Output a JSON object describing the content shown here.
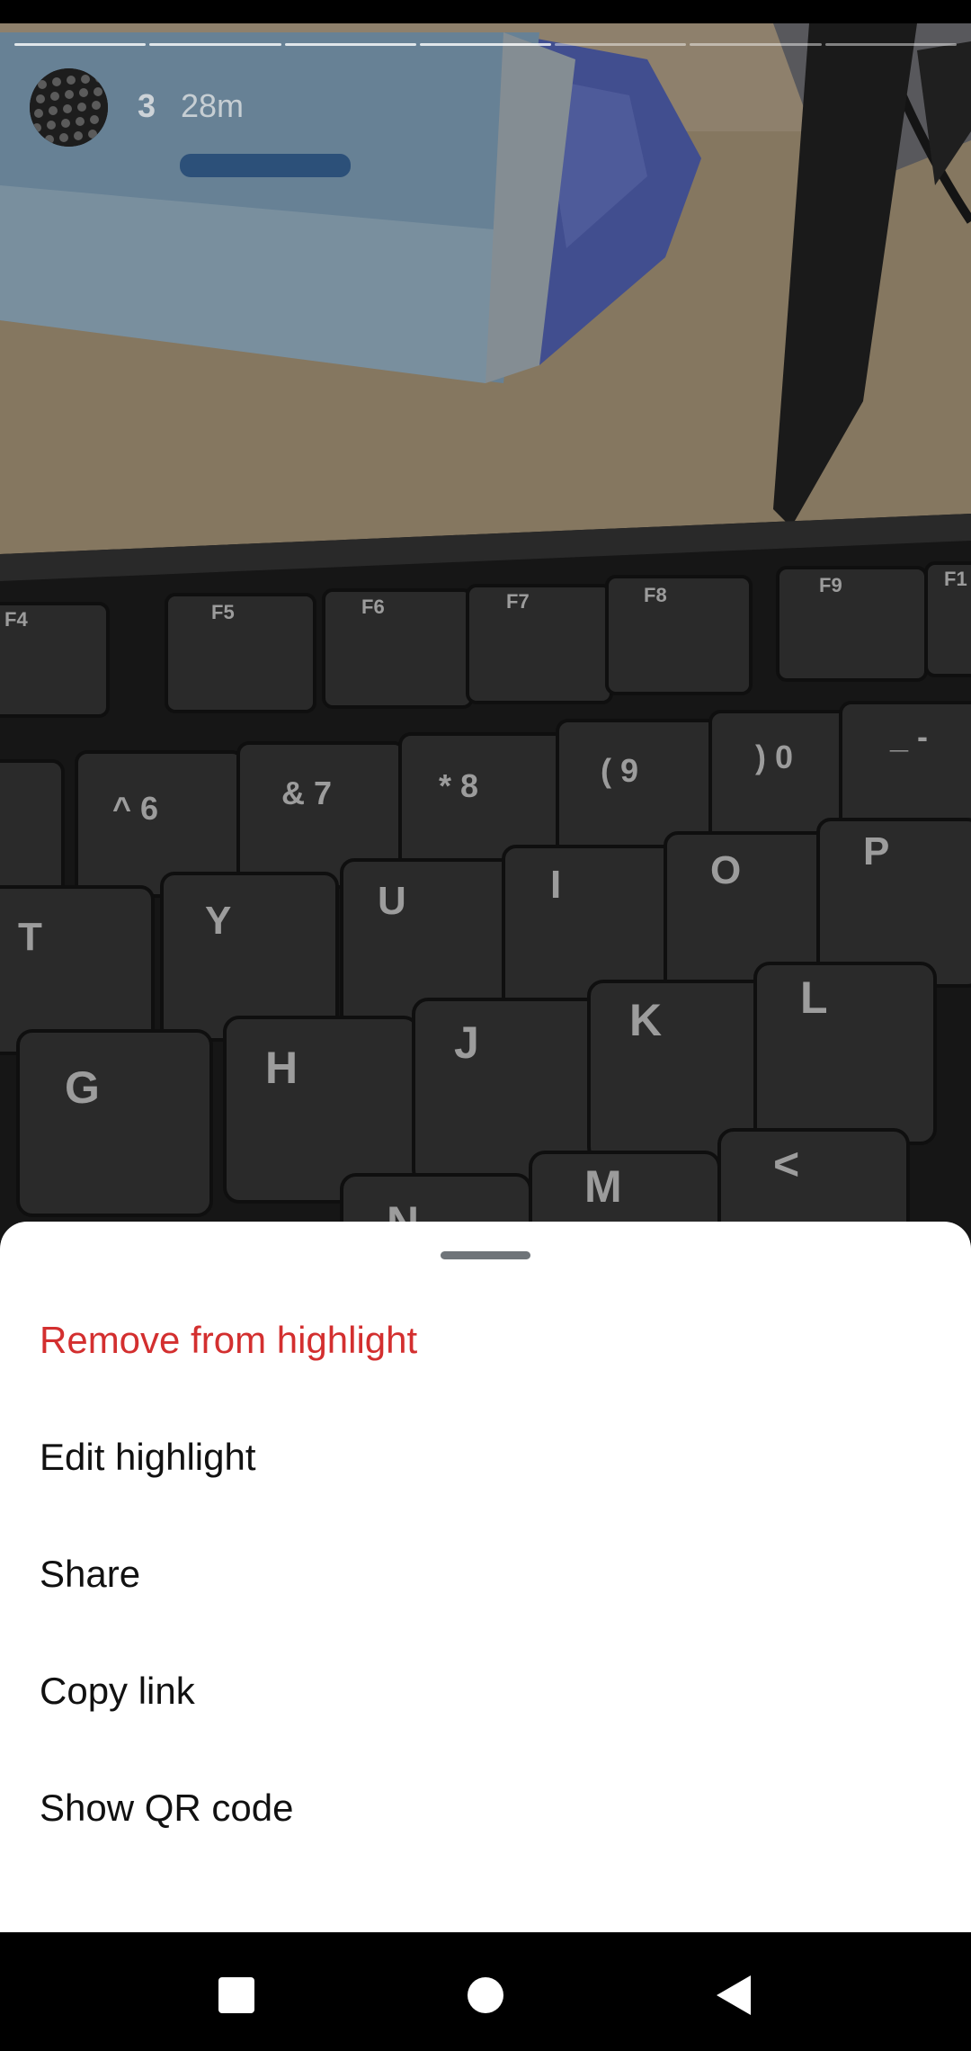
{
  "story": {
    "username": "3",
    "timestamp": "28m",
    "progress_segments": 7,
    "current_segment": 4,
    "photo": {
      "subject": "keyboard-photo",
      "key_labels_row1": [
        "F4",
        "F5",
        "F6",
        "F7",
        "F8",
        "F9",
        "F1"
      ],
      "key_labels_row2": [
        "^\n6",
        "&\n7",
        "*\n8",
        "(\n9",
        ")\n0",
        "_\n-"
      ],
      "key_labels_row3": [
        "T",
        "Y",
        "U",
        "I",
        "O",
        "P"
      ],
      "key_labels_row4": [
        "G",
        "H",
        "J",
        "K",
        "L"
      ],
      "key_labels_row5": [
        "N",
        "M",
        "<"
      ]
    }
  },
  "menu": {
    "items": [
      {
        "label": "Remove from highlight",
        "style": "danger"
      },
      {
        "label": "Edit highlight",
        "style": "normal"
      },
      {
        "label": "Share",
        "style": "normal"
      },
      {
        "label": "Copy link",
        "style": "normal"
      },
      {
        "label": "Show QR code",
        "style": "normal"
      }
    ]
  },
  "colors": {
    "danger": "#d32f2f",
    "sheet_background": "#ffffff",
    "nav_background": "#000000"
  },
  "navigation": {
    "recents_icon": "square-icon",
    "home_icon": "circle-icon",
    "back_icon": "triangle-back-icon"
  }
}
